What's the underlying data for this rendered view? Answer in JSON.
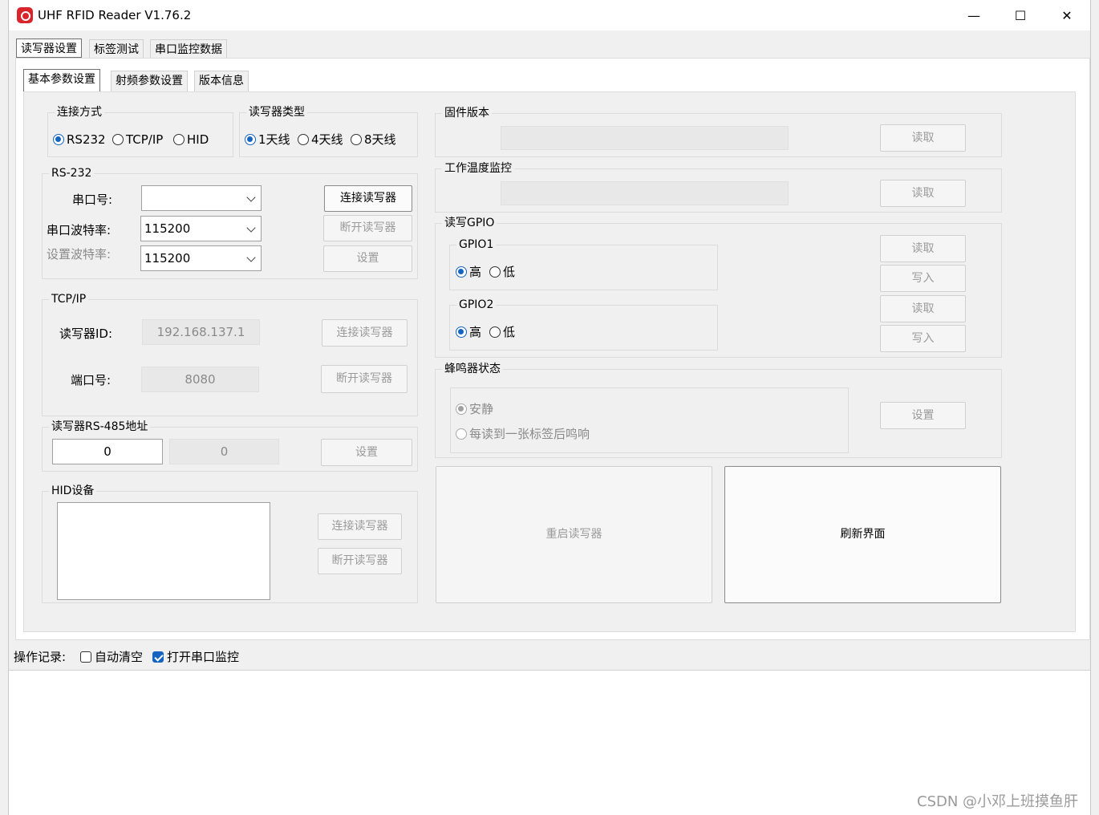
{
  "window": {
    "title": "UHF RFID Reader V1.76.2",
    "minimize": "—",
    "maximize": "☐",
    "close": "✕"
  },
  "top_tabs": [
    "读写器设置",
    "标签测试",
    "串口监控数据"
  ],
  "sub_tabs": [
    "基本参数设置",
    "射频参数设置",
    "版本信息"
  ],
  "connection": {
    "legend": "连接方式",
    "options": [
      "RS232",
      "TCP/IP",
      "HID"
    ],
    "selected": "RS232"
  },
  "reader_type": {
    "legend": "读写器类型",
    "options": [
      "1天线",
      "4天线",
      "8天线"
    ],
    "selected": "1天线"
  },
  "rs232": {
    "legend": "RS-232",
    "port_label": "串口号:",
    "port_value": "",
    "baud_label": "串口波特率:",
    "baud_value": "115200",
    "set_baud_label": "设置波特率:",
    "set_baud_value": "115200",
    "connect": "连接读写器",
    "disconnect": "断开读写器",
    "set": "设置"
  },
  "tcpip": {
    "legend": "TCP/IP",
    "id_label": "读写器ID:",
    "id_value": "192.168.137.1",
    "port_label": "端口号:",
    "port_value": "8080",
    "connect": "连接读写器",
    "disconnect": "断开读写器"
  },
  "rs485": {
    "legend": "读写器RS-485地址",
    "address_value": "0",
    "readonly_value": "0",
    "set": "设置"
  },
  "hid": {
    "legend": "HID设备",
    "connect": "连接读写器",
    "disconnect": "断开读写器"
  },
  "firmware": {
    "legend": "固件版本",
    "value": "",
    "read": "读取"
  },
  "temperature": {
    "legend": "工作温度监控",
    "value": "",
    "read": "读取"
  },
  "gpio": {
    "legend": "读写GPIO",
    "gpio1": {
      "legend": "GPIO1",
      "options": [
        "高",
        "低"
      ],
      "selected": "高"
    },
    "gpio2": {
      "legend": "GPIO2",
      "options": [
        "高",
        "低"
      ],
      "selected": "高"
    },
    "read1": "读取",
    "write1": "写入",
    "read2": "读取",
    "write2": "写入"
  },
  "buzzer": {
    "legend": "蜂鸣器状态",
    "options": [
      "安静",
      "每读到一张标签后鸣响"
    ],
    "selected": "安静",
    "set": "设置"
  },
  "actions": {
    "restart": "重启读写器",
    "refresh": "刷新界面"
  },
  "log": {
    "label": "操作记录:",
    "auto_clear": "自动清空",
    "auto_clear_checked": false,
    "open_monitor": "打开串口监控",
    "open_monitor_checked": true
  },
  "watermark": "CSDN @小邓上班摸鱼肝"
}
